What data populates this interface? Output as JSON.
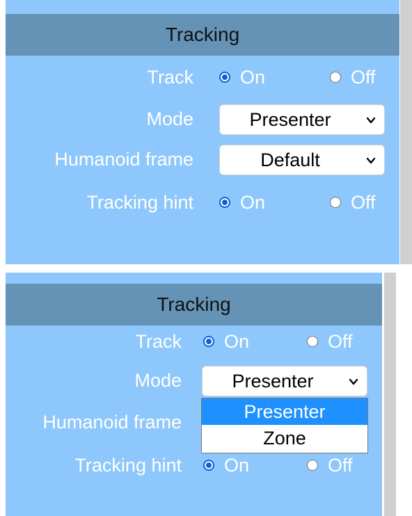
{
  "top_panel": {
    "header": "Tracking",
    "track": {
      "label": "Track",
      "options": [
        "On",
        "Off"
      ],
      "selected": "On"
    },
    "mode": {
      "label": "Mode",
      "value": "Presenter"
    },
    "humanoid_frame": {
      "label": "Humanoid frame",
      "value": "Default"
    },
    "tracking_hint": {
      "label": "Tracking hint",
      "options": [
        "On",
        "Off"
      ],
      "selected": "On"
    }
  },
  "bottom_panel": {
    "header": "Tracking",
    "track": {
      "label": "Track",
      "options": [
        "On",
        "Off"
      ],
      "selected": "On"
    },
    "mode": {
      "label": "Mode",
      "value": "Presenter",
      "dropdown_open": true,
      "options": [
        "Presenter",
        "Zone"
      ],
      "highlighted": "Presenter"
    },
    "humanoid_frame": {
      "label": "Humanoid frame"
    },
    "tracking_hint": {
      "label": "Tracking hint",
      "options": [
        "On",
        "Off"
      ],
      "selected": "On"
    }
  },
  "colors": {
    "panel_bg": "#8ec7fb",
    "header_bg": "#6593b6",
    "radio_accent": "#0f5fd6",
    "dropdown_highlight": "#1e90ff"
  }
}
